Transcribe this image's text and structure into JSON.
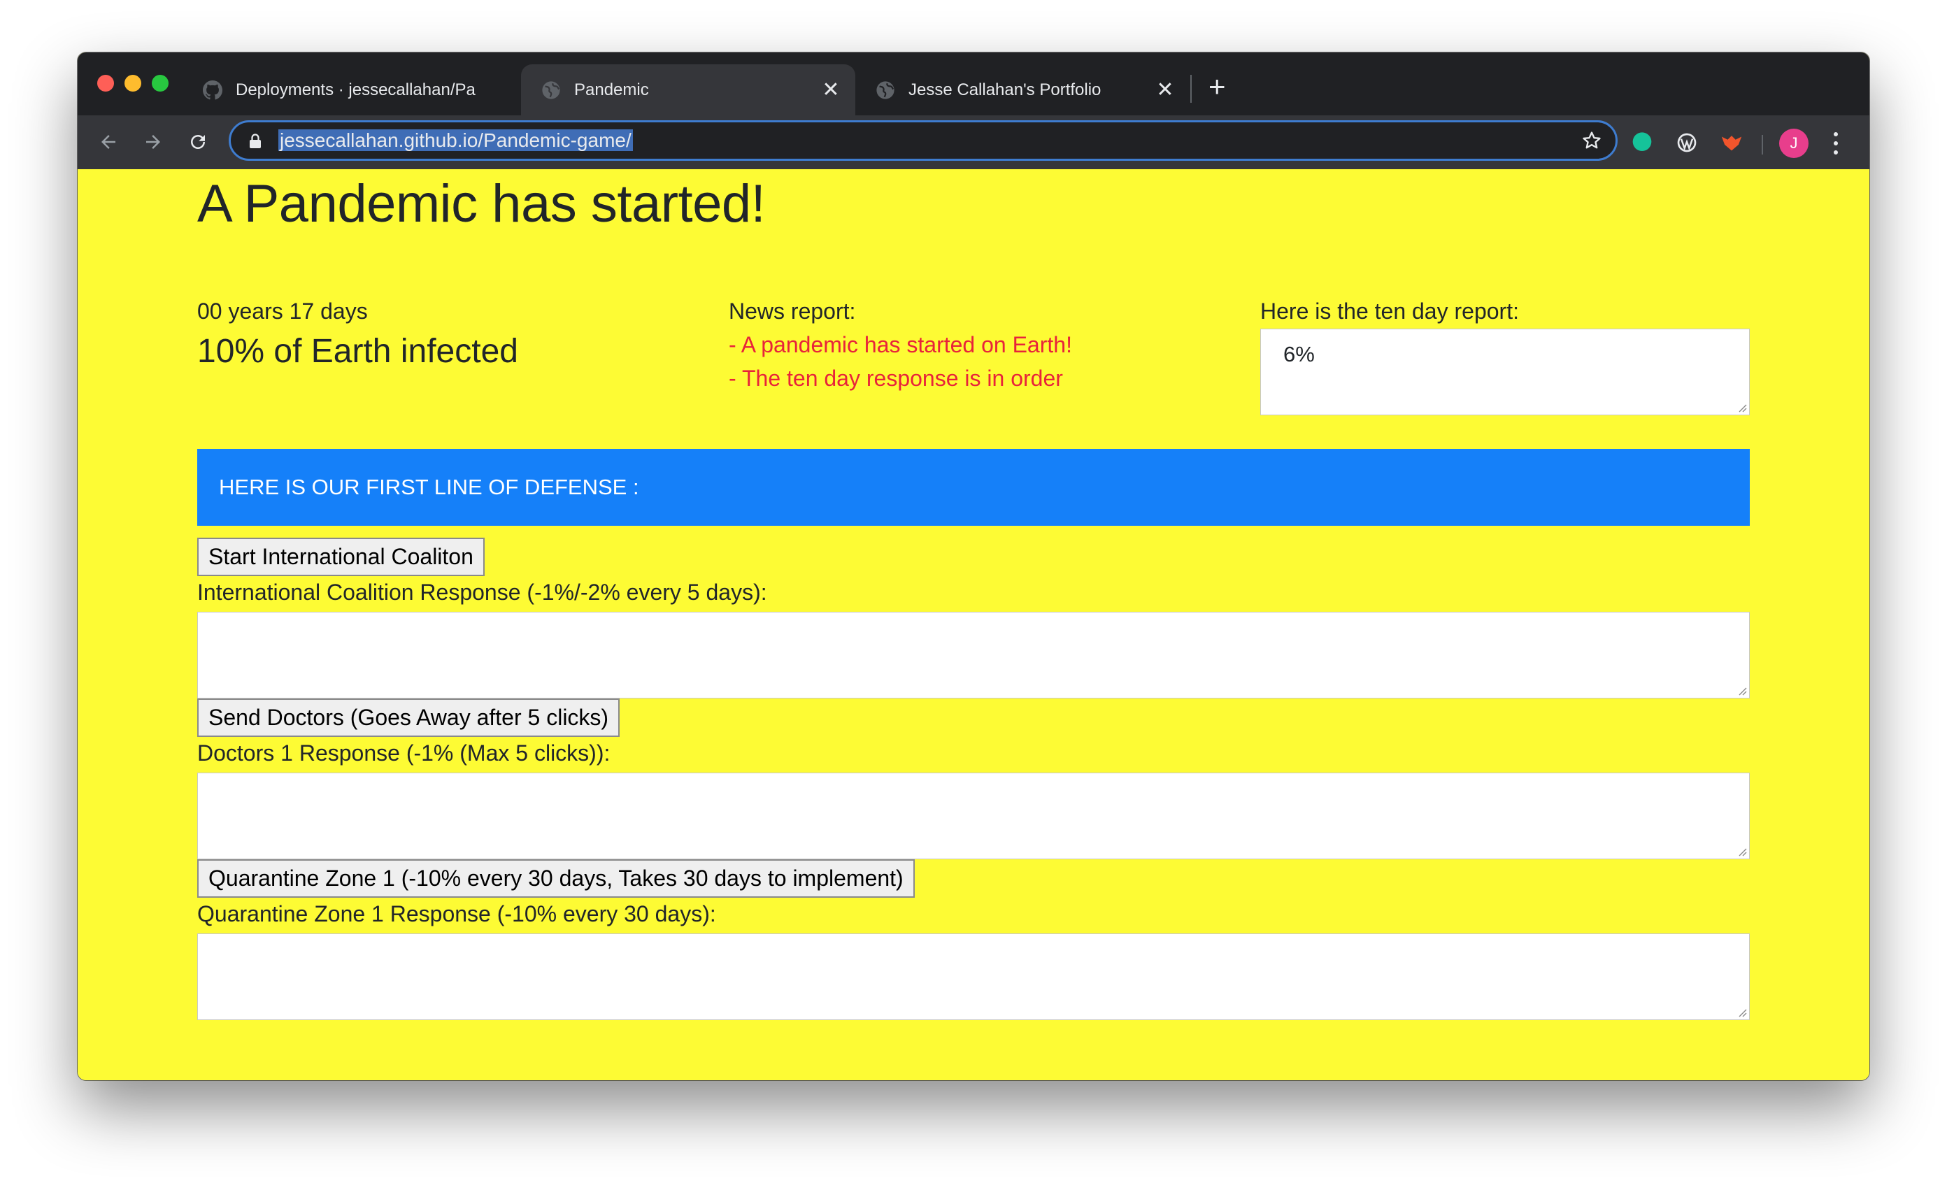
{
  "browser": {
    "tabs": [
      {
        "title": "Deployments · jessecallahan/Pa",
        "favicon": "github-icon",
        "active": false
      },
      {
        "title": "Pandemic",
        "favicon": "globe-icon",
        "active": true
      },
      {
        "title": "Jesse Callahan's Portfolio",
        "favicon": "globe-icon",
        "active": false
      }
    ],
    "new_tab": "+",
    "url": "jessecallahan.github.io/Pandemic-game/",
    "avatar_letter": "J",
    "extensions": [
      "grammarly-icon",
      "wordpress-icon",
      "fox-extension-icon"
    ]
  },
  "page": {
    "title": "A Pandemic has started!",
    "time_elapsed": "00 years 17 days",
    "infected": "10% of Earth infected",
    "news": {
      "label": "News report:",
      "items": [
        "- A pandemic has started on Earth!",
        "- The ten day response is in order"
      ]
    },
    "ten_day": {
      "label": "Here is the ten day report:",
      "value": "6%"
    },
    "defense_banner": "HERE IS OUR FIRST LINE OF DEFENSE :",
    "actions": [
      {
        "button": "Start International Coaliton",
        "response_label": "International Coalition Response (-1%/-2% every 5 days):",
        "response_value": ""
      },
      {
        "button": "Send Doctors (Goes Away after 5 clicks)",
        "response_label": "Doctors 1 Response (-1% (Max 5 clicks)):",
        "response_value": ""
      },
      {
        "button": "Quarantine Zone 1 (-10% every 30 days, Takes 30 days to implement)",
        "response_label": "Quarantine Zone 1 Response (-10% every 30 days):",
        "response_value": ""
      }
    ]
  },
  "colors": {
    "page_background": "#fdfb34",
    "banner": "#1580f9",
    "news_text": "#e8233a"
  }
}
